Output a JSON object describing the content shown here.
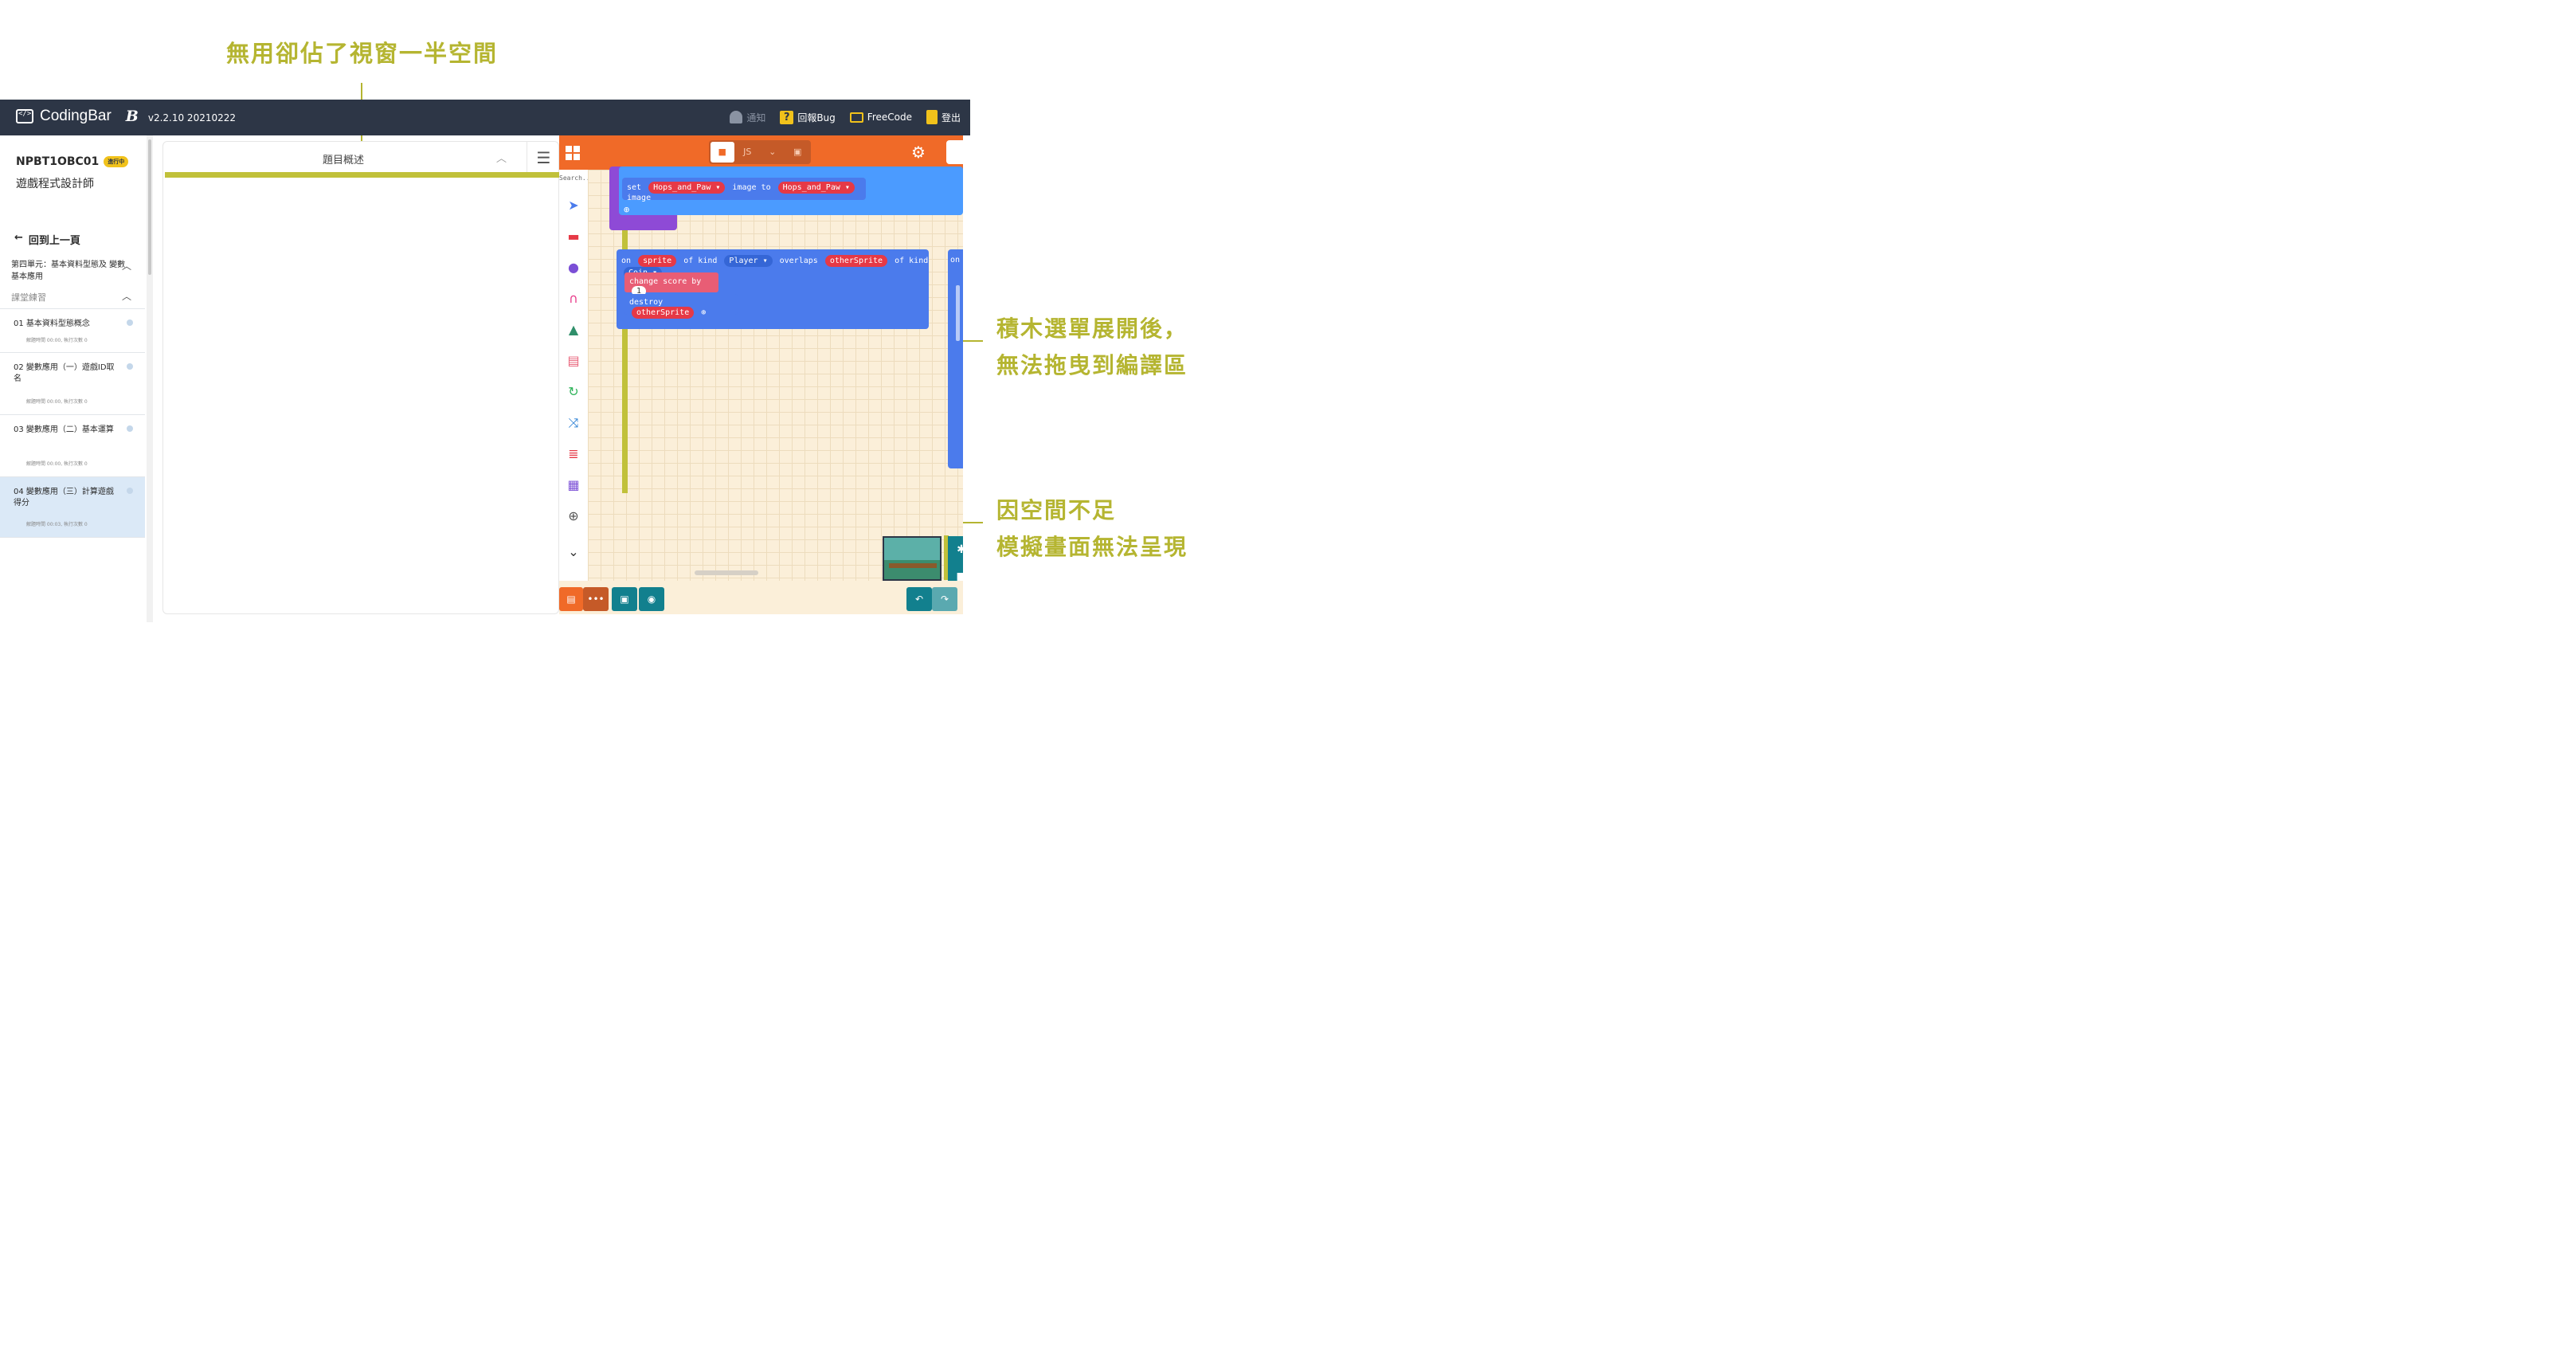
{
  "annotations": {
    "top": "無用卻佔了視窗一半空間",
    "middle_line1": "積木選單展開後，",
    "middle_line2": "無法拖曳到編譯區",
    "bottom_line1": "因空間不足",
    "bottom_line2": "模擬畫面無法呈現"
  },
  "topbar": {
    "brand": "CodingBar",
    "brand_mark": "B",
    "version": "v2.2.10 20210222",
    "nav": [
      {
        "label": "通知",
        "icon": "bell-icon"
      },
      {
        "label": "回報Bug",
        "icon": "question-icon"
      },
      {
        "label": "FreeCode",
        "icon": "code-icon"
      },
      {
        "label": "登出",
        "icon": "logout-icon"
      }
    ]
  },
  "sidebar": {
    "course_code": "NPBT1OBC01",
    "status_badge": "進行中",
    "course_name": "遊戲程式設計師",
    "back_label": "回到上一頁",
    "unit_title": "第四單元：基本資料型態及 變數基本應用",
    "section_label": "課堂練習",
    "items": [
      {
        "title": "01  基本資料型態概念",
        "meta": "解題時間 00:00, 執行次數 0"
      },
      {
        "title": "02  變數應用（一）遊戲ID取名",
        "meta": "解題時間 00:00, 執行次數 0"
      },
      {
        "title": "03  變數應用（二）基本運算",
        "meta": "解題時間 00:00, 執行次數 0"
      },
      {
        "title": "04  變數應用（三）計算遊戲得分",
        "meta": "解題時間 00:03, 執行次數 0"
      }
    ]
  },
  "description_panel": {
    "title": "題目概述"
  },
  "editor": {
    "search_placeholder": "Search...",
    "view_js": "JS",
    "blocks": {
      "set_stmt": [
        "set",
        "Hops_and_Paw ▾",
        "image to",
        "Hops_and_Paw ▾",
        "image"
      ],
      "on_overlap": [
        "on",
        "sprite",
        "of kind",
        "Player ▾",
        "overlaps",
        "otherSprite",
        "of kind",
        "Coin ▾"
      ],
      "change_score": [
        "change score by",
        "1"
      ],
      "destroy": [
        "destroy",
        "otherSprite"
      ],
      "partial_on": "on"
    }
  }
}
